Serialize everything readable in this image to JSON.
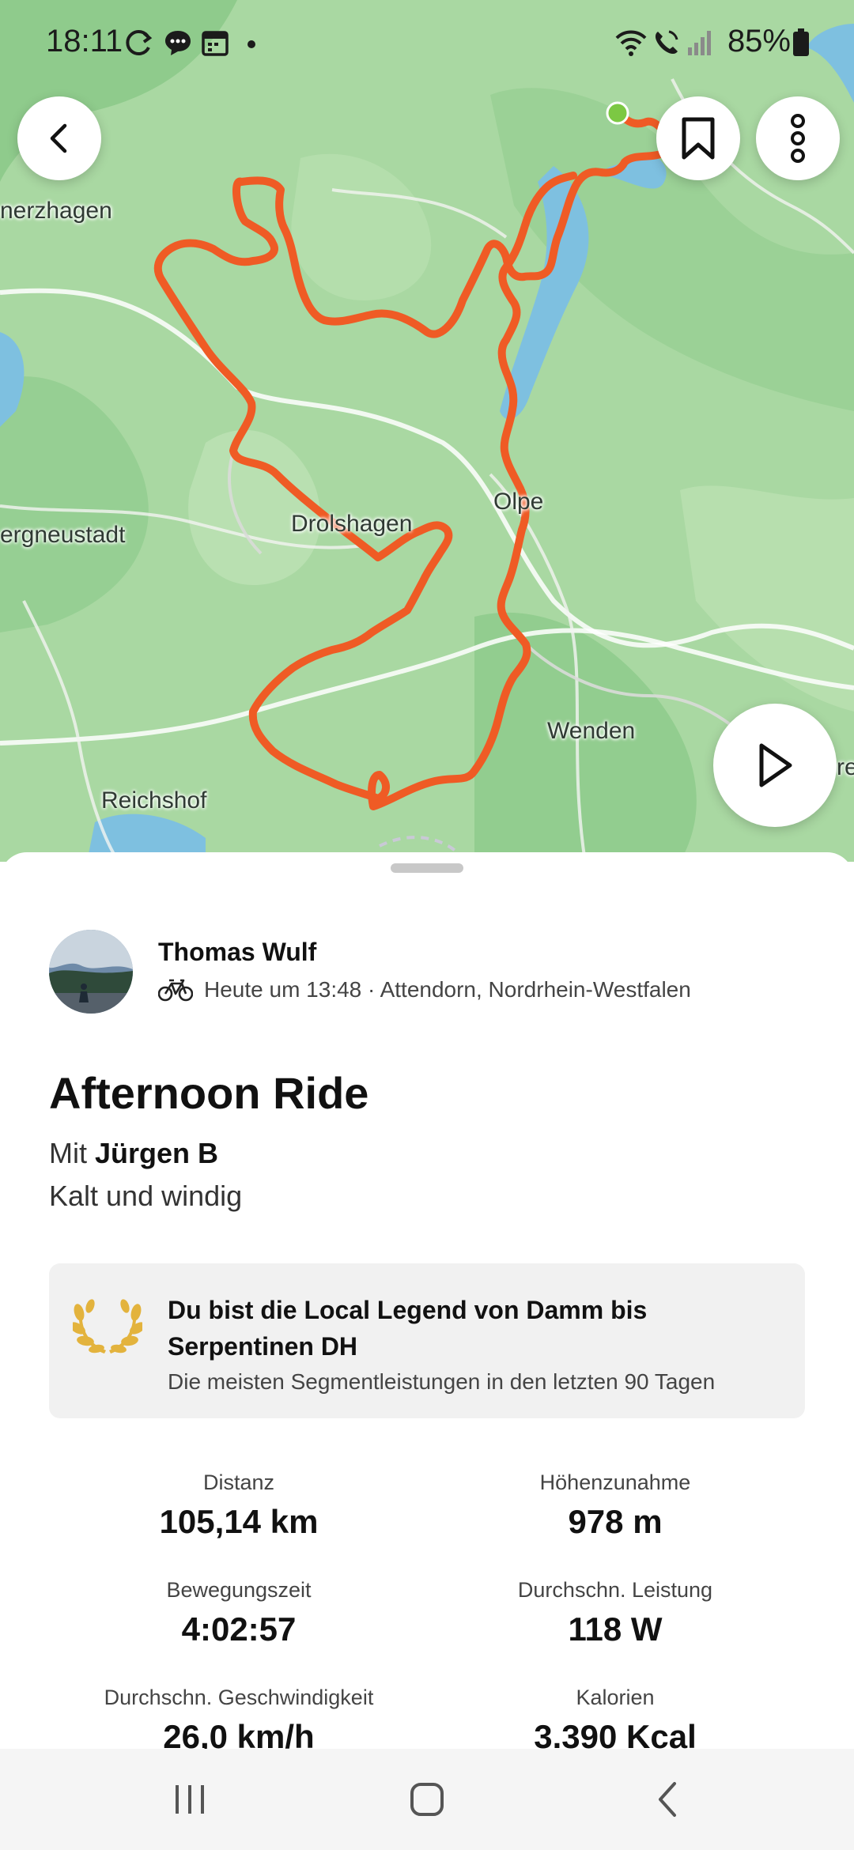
{
  "status_bar": {
    "time": "18:11",
    "battery": "85%"
  },
  "map": {
    "places": [
      "nerzhagen",
      "Drolshagen",
      "Olpe",
      "ergneustadt",
      "Wenden",
      "Reichshof",
      "re"
    ],
    "route_color": "#ef5b25",
    "start_color": "#7cc843"
  },
  "activity": {
    "athlete": "Thomas Wulf",
    "meta": "Heute um 13:48 · Attendorn, Nordrhein-Westfalen",
    "title": "Afternoon Ride",
    "with_prefix": "Mit",
    "with_name": "Jürgen B",
    "description": "Kalt und windig"
  },
  "local_legend": {
    "title": "Du bist die Local Legend von Damm bis Serpentinen DH",
    "subtitle": "Die meisten Segmentleistungen in den letzten 90 Tagen",
    "accent": "#e3b33d"
  },
  "stats": [
    {
      "label": "Distanz",
      "value": "105,14 km"
    },
    {
      "label": "Höhenzunahme",
      "value": "978 m"
    },
    {
      "label": "Bewegungszeit",
      "value": "4:02:57"
    },
    {
      "label": "Durchschn. Leistung",
      "value": "118 W"
    },
    {
      "label": "Durchschn. Geschwindigkeit",
      "value": "26,0 km/h"
    },
    {
      "label": "Kalorien",
      "value": "3.390 Kcal"
    }
  ]
}
